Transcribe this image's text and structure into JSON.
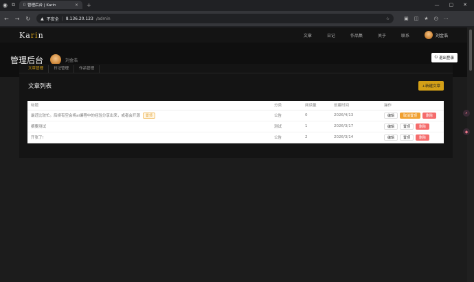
{
  "browser": {
    "tab_title": "管理后台 | Karin",
    "insecure_label": "不安全",
    "url_host": "8.136.20.123",
    "url_path": "/admin"
  },
  "site": {
    "logo_main": "Ka",
    "logo_accent": "ri",
    "logo_end": "n",
    "nav": [
      "文章",
      "日记",
      "作品集",
      "关于",
      "联系"
    ],
    "user_name": "刘金浩"
  },
  "hero": {
    "title": "管理后台",
    "user_name": "刘金浩",
    "logout_label": "退出登录"
  },
  "tabs": [
    {
      "label": "文章管理",
      "active": true
    },
    {
      "label": "日记管理",
      "active": false
    },
    {
      "label": "作品管理",
      "active": false
    }
  ],
  "list": {
    "title": "文章列表",
    "new_button": "+新建文章",
    "columns": [
      "标题",
      "分类",
      "阅读量",
      "创建时间",
      "操作"
    ],
    "rows": [
      {
        "title": "最近比较忙。后续有空会将ai编程中的经验分享出来，或者会开源",
        "badge": "置顶",
        "category": "公告",
        "views": "0",
        "date": "2026/4/13",
        "actions": [
          "编辑",
          "取消置顶",
          "删除"
        ]
      },
      {
        "title": "摘要测试",
        "badge": "",
        "category": "测试",
        "views": "1",
        "date": "2026/3/17",
        "actions": [
          "编辑",
          "置顶",
          "删除"
        ]
      },
      {
        "title": "开张了!",
        "badge": "",
        "category": "公告",
        "views": "2",
        "date": "2026/3/14",
        "actions": [
          "编辑",
          "置顶",
          "删除"
        ]
      }
    ]
  },
  "colors": {
    "accent": "#d4a017",
    "danger": "#f56c6c",
    "warning": "#f0a030"
  }
}
